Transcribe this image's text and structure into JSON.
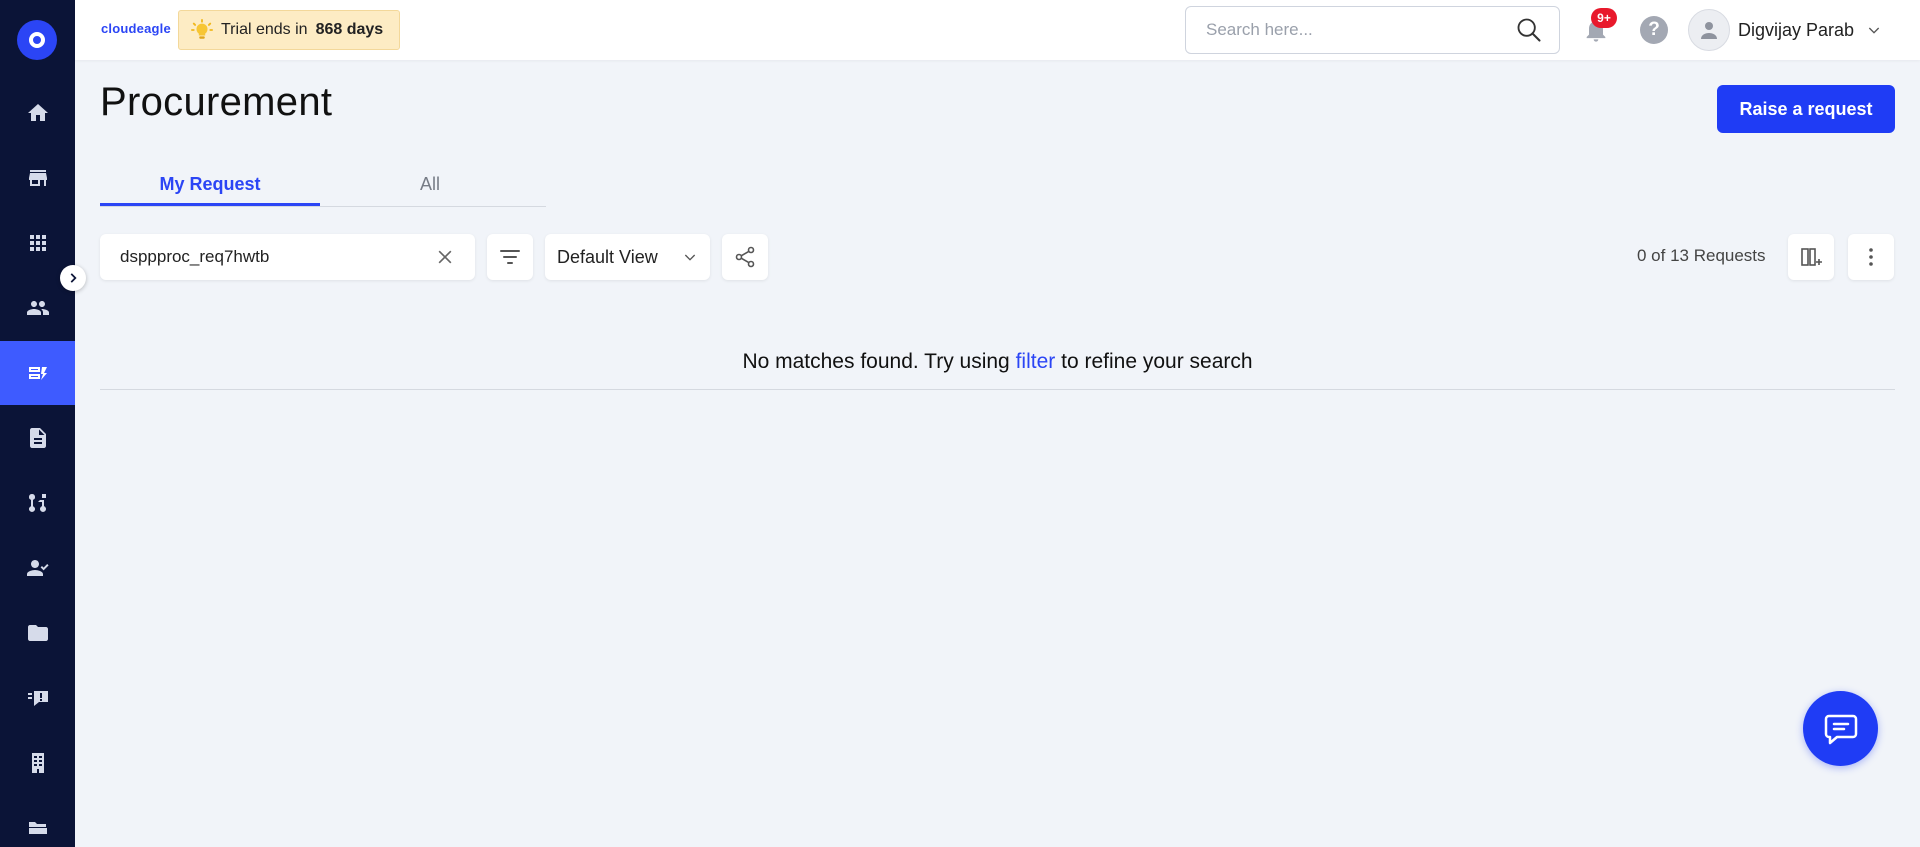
{
  "topbar": {
    "brand": "cloudeagle",
    "trial_prefix": "Trial ends in",
    "trial_days": "868 days",
    "search_placeholder": "Search here...",
    "notification_badge": "9+",
    "user_name": "Digvijay Parab"
  },
  "sidebar": {
    "items": [
      {
        "icon": "home-icon"
      },
      {
        "icon": "store-icon"
      },
      {
        "icon": "apps-grid-icon"
      },
      {
        "icon": "users-icon"
      },
      {
        "icon": "procurement-icon",
        "active": true
      },
      {
        "icon": "document-icon"
      },
      {
        "icon": "workflow-icon"
      },
      {
        "icon": "user-check-icon"
      },
      {
        "icon": "folder-icon"
      },
      {
        "icon": "feedback-icon"
      },
      {
        "icon": "building-icon"
      },
      {
        "icon": "folder-open-icon"
      }
    ]
  },
  "main": {
    "title": "Procurement",
    "raise_request_label": "Raise a request",
    "tabs": [
      {
        "label": "My Request",
        "active": true
      },
      {
        "label": "All",
        "active": false
      }
    ],
    "search_value": "dsppproc_req7hwtb",
    "view_label": "Default View",
    "count_text": "0 of 13 Requests",
    "empty_prefix": "No matches found. Try using",
    "empty_link": "filter",
    "empty_suffix": "to refine your search"
  },
  "colors": {
    "accent": "#1f3cf5",
    "sidebar_bg": "#0b1437",
    "sidebar_active": "#3e5bff",
    "page_bg": "#f1f4f9",
    "badge": "#e8192c",
    "trial_bg": "#fdecc4"
  }
}
